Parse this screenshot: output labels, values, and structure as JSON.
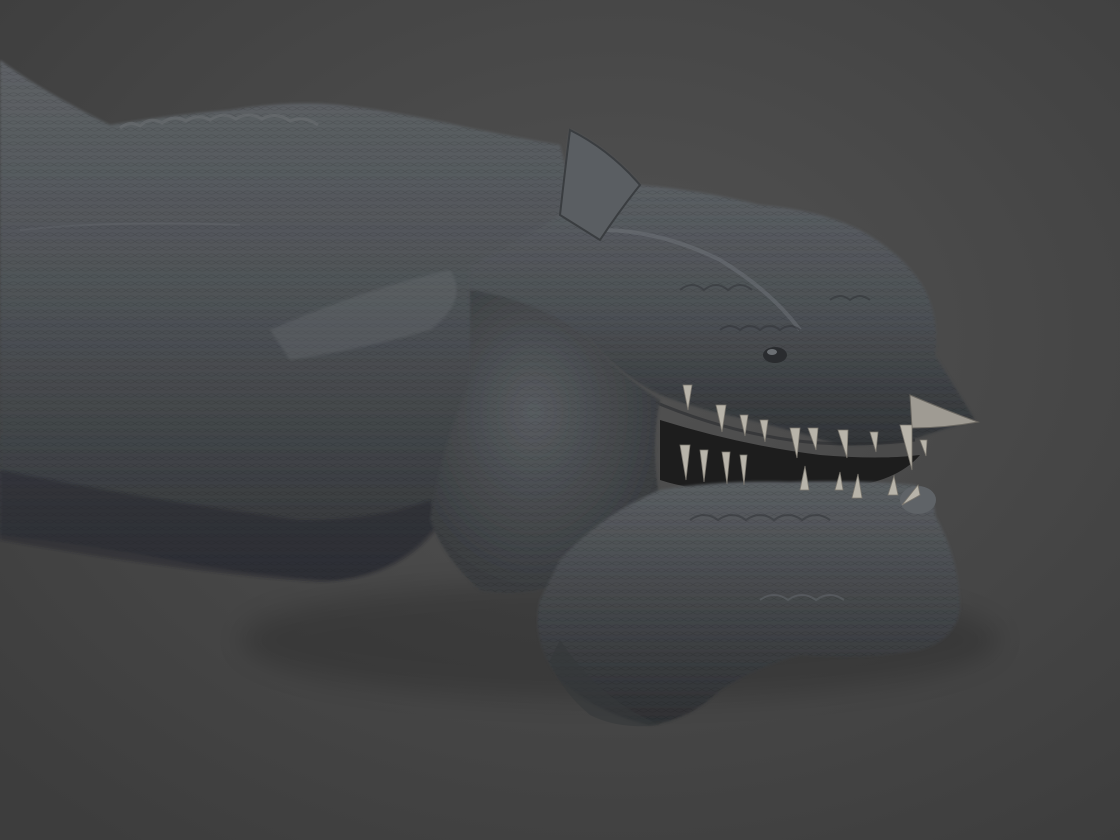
{
  "scene": {
    "subject": "creature-head-sculpt",
    "colors": {
      "background": "#4a4a4a",
      "background_dark": "#3f3f3f",
      "skin_base": "#4f5256",
      "skin_light": "#6c7074",
      "skin_shadow": "#2f3134",
      "mouth_interior": "#1d1d1d",
      "tooth": "#b8b4aa"
    },
    "icons": [
      "creature-head",
      "teeth",
      "horn",
      "eye"
    ]
  }
}
